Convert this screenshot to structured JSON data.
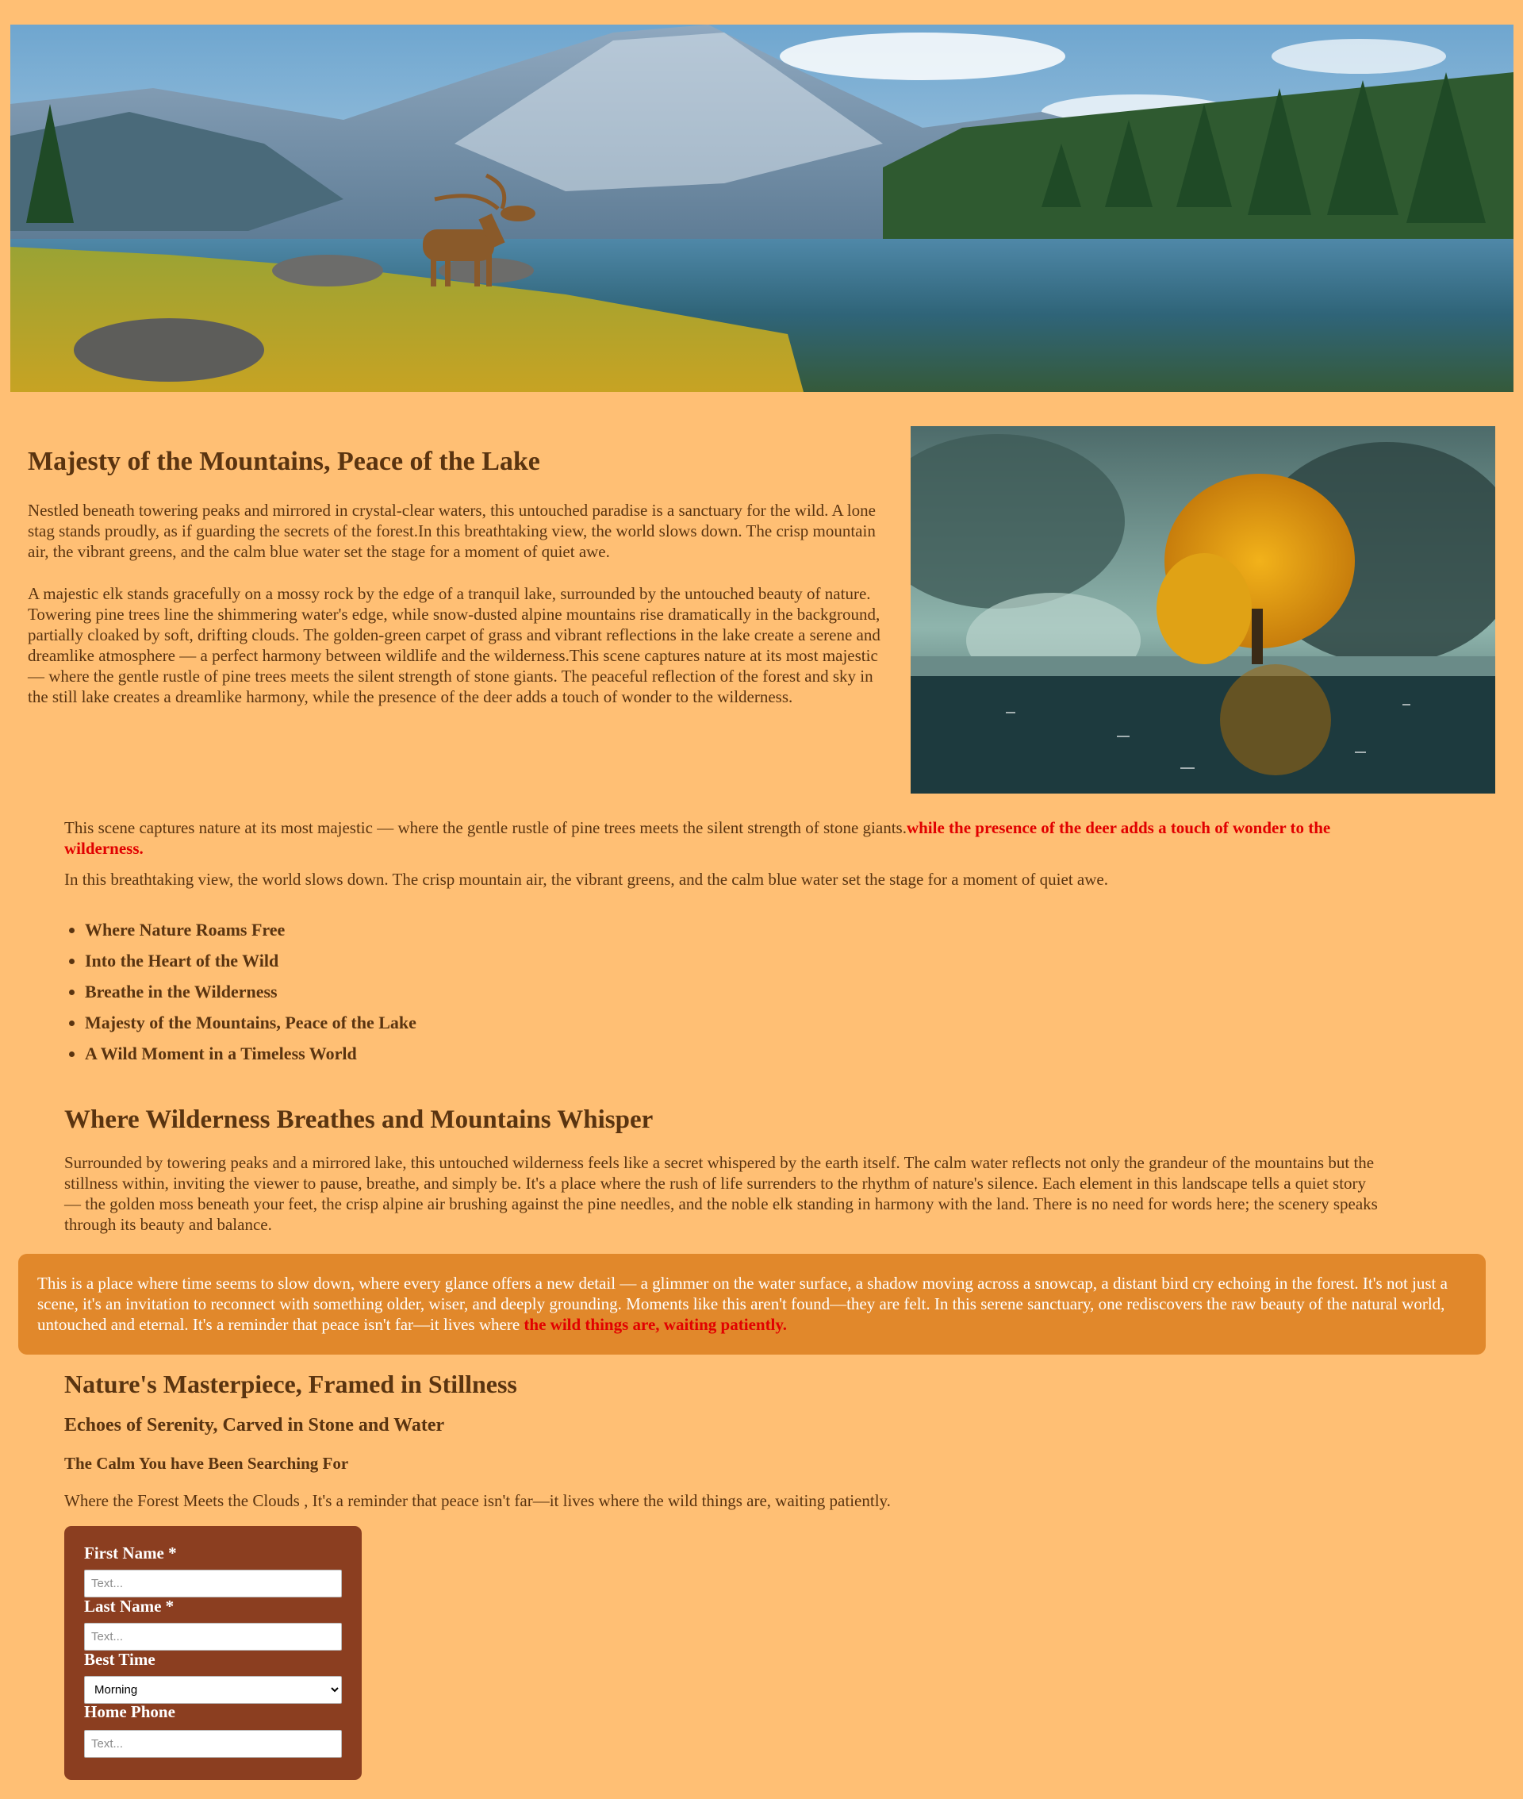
{
  "colors": {
    "page_bg": "#ffbf74",
    "text": "#5a3410",
    "accent_red": "#e10000",
    "callout_bg": "#e1882b",
    "form_bg": "#8b3e20"
  },
  "hero": {
    "image": "mountain-lake-elk"
  },
  "intro": {
    "heading": "Majesty of the Mountains, Peace of the Lake",
    "p1": "Nestled beneath towering peaks and mirrored in crystal-clear waters, this untouched paradise is a sanctuary for the wild. A lone stag stands proudly, as if guarding the secrets of the forest.In this breathtaking view, the world slows down. The crisp mountain air, the vibrant greens, and the calm blue water set the stage for a moment of quiet awe.",
    "p2": "A majestic elk stands gracefully on a mossy rock by the edge of a tranquil lake, surrounded by the untouched beauty of nature. Towering pine trees line the shimmering water's edge, while snow-dusted alpine mountains rise dramatically in the background, partially cloaked by soft, drifting clouds. The golden-green carpet of grass and vibrant reflections in the lake create a serene and dreamlike atmosphere — a perfect harmony between wildlife and the wilderness.This scene captures nature at its most majestic — where the gentle rustle of pine trees meets the silent strength of stone giants. The peaceful reflection of the forest and sky in the still lake creates a dreamlike harmony, while the presence of the deer adds a touch of wonder to the wilderness.",
    "side_image": "golden-willow-misty-lake"
  },
  "scene": {
    "text": "This scene captures nature at its most majestic — where the gentle rustle of pine trees meets the silent strength of stone giants.",
    "highlight": "while the presence of the deer adds a touch of wonder to the wilderness.",
    "view": "In this breathtaking view, the world slows down. The crisp mountain air, the vibrant greens, and the calm blue water set the stage for a moment of quiet awe."
  },
  "highlights": [
    "Where Nature Roams Free",
    "Into the Heart of the Wild",
    "Breathe in the Wilderness",
    "Majesty of the Mountains, Peace of the Lake",
    "A Wild Moment in a Timeless World"
  ],
  "section2": {
    "heading": "Where Wilderness Breathes and Mountains Whisper",
    "text": "Surrounded by towering peaks and a mirrored lake, this untouched wilderness feels like a secret whispered by the earth itself. The calm water reflects not only the grandeur of the mountains but the stillness within, inviting the viewer to pause, breathe, and simply be. It's a place where the rush of life surrenders to the rhythm of nature's silence. Each element in this landscape tells a quiet story — the golden moss beneath your feet, the crisp alpine air brushing against the pine needles, and the noble elk standing in harmony with the land. There is no need for words here; the scenery speaks through its beauty and balance."
  },
  "callout": {
    "text": "This is a place where time seems to slow down, where every glance offers a new detail — a glimmer on the water surface, a shadow moving across a snowcap, a distant bird cry echoing in the forest. It's not just a scene, it's an invitation to reconnect with something older, wiser, and deeply grounding. Moments like this aren't found—they are felt. In this serene sanctuary, one rediscovers the raw beauty of the natural world, untouched and eternal. It's a reminder that peace isn't far—it lives where ",
    "highlight": "the wild things are, waiting patiently."
  },
  "masterpiece": {
    "heading": "Nature's Masterpiece, Framed in Stillness",
    "subheading": "Echoes of Serenity, Carved in Stone and Water",
    "subsubheading": "The Calm You have Been Searching For",
    "text": "Where the Forest Meets the Clouds , It's a reminder that peace isn't far—it lives where the wild things are, waiting patiently."
  },
  "form": {
    "first_name_label": "First Name *",
    "first_name_placeholder": "Text...",
    "last_name_label": "Last Name *",
    "last_name_placeholder": "Text...",
    "best_time_label": "Best Time",
    "best_time_value": "Morning",
    "home_phone_label": "Home Phone",
    "home_phone_placeholder": "Text..."
  }
}
